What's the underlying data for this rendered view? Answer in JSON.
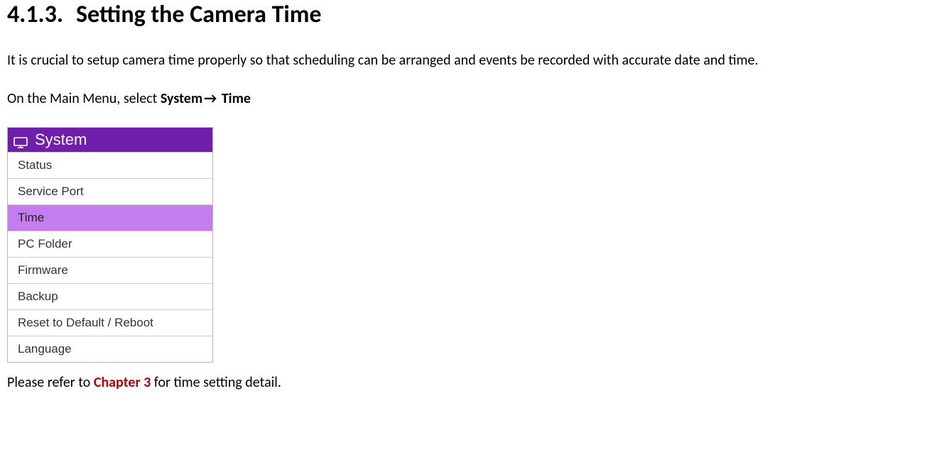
{
  "heading": {
    "number": "4.1.3.",
    "title": "Setting the Camera Time"
  },
  "intro_paragraph": "It is crucial to setup camera time properly so that scheduling can be arranged and events be recorded with accurate date and time.",
  "nav_sentence": {
    "prefix": "On the Main Menu, select ",
    "bold_part1": "System",
    "bold_part2": "Time"
  },
  "menu": {
    "title": "System",
    "items": [
      {
        "label": "Status",
        "selected": false
      },
      {
        "label": "Service Port",
        "selected": false
      },
      {
        "label": "Time",
        "selected": true
      },
      {
        "label": "PC Folder",
        "selected": false
      },
      {
        "label": "Firmware",
        "selected": false
      },
      {
        "label": "Backup",
        "selected": false
      },
      {
        "label": "Reset to Default / Reboot",
        "selected": false
      },
      {
        "label": "Language",
        "selected": false
      }
    ]
  },
  "footer": {
    "prefix": "Please refer to ",
    "bold_red": "Chapter 3",
    "suffix": " for time setting detail."
  }
}
